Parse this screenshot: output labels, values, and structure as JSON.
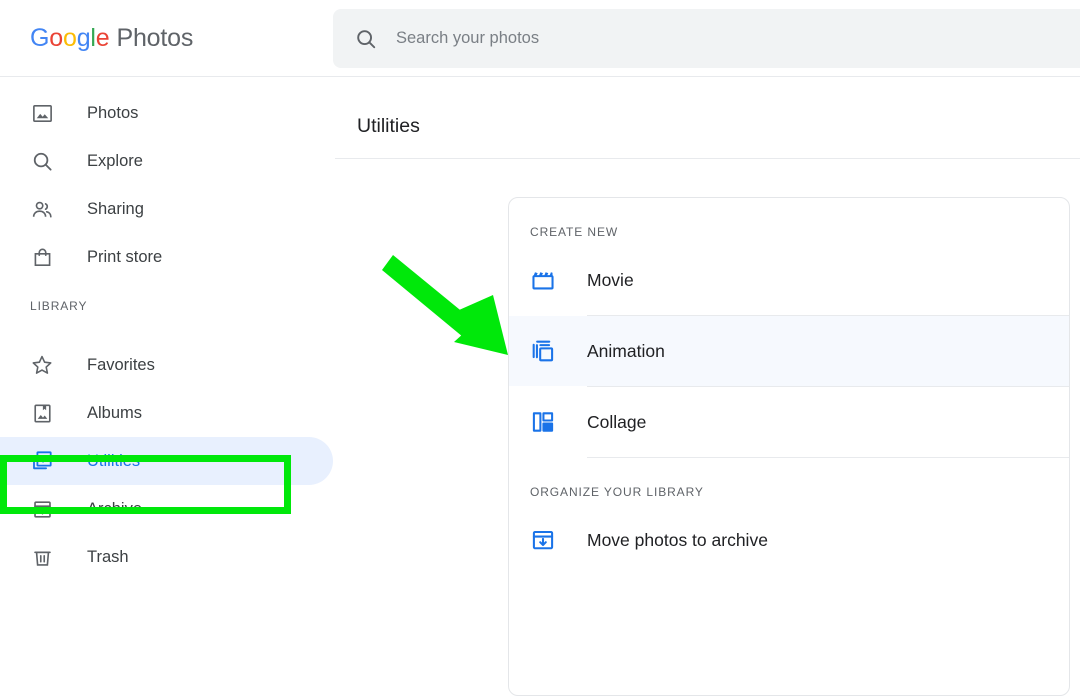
{
  "header": {
    "brand": {
      "google_letters": [
        "G",
        "o",
        "o",
        "g",
        "l",
        "e"
      ],
      "product": "Photos"
    },
    "search": {
      "placeholder": "Search your photos",
      "value": "",
      "icon": "search-icon"
    }
  },
  "sidebar": {
    "primary_items": [
      {
        "label": "Photos",
        "icon": "photo-icon",
        "active": false
      },
      {
        "label": "Explore",
        "icon": "search-icon",
        "active": false
      },
      {
        "label": "Sharing",
        "icon": "people-icon",
        "active": false
      },
      {
        "label": "Print store",
        "icon": "shopping-bag-icon",
        "active": false
      }
    ],
    "library_section_label": "LIBRARY",
    "library_items": [
      {
        "label": "Favorites",
        "icon": "star-icon",
        "active": false
      },
      {
        "label": "Albums",
        "icon": "album-icon",
        "active": false
      },
      {
        "label": "Utilities",
        "icon": "utilities-icon",
        "active": true
      },
      {
        "label": "Archive",
        "icon": "archive-icon",
        "active": false
      },
      {
        "label": "Trash",
        "icon": "trash-icon",
        "active": false
      }
    ]
  },
  "main": {
    "page_title": "Utilities",
    "card": {
      "create_new_label": "CREATE NEW",
      "create_new_items": [
        {
          "label": "Movie",
          "icon": "movie-clapper-icon",
          "hovered": false
        },
        {
          "label": "Animation",
          "icon": "layers-icon",
          "hovered": true
        },
        {
          "label": "Collage",
          "icon": "collage-grid-icon",
          "hovered": false
        }
      ],
      "organize_label": "ORGANIZE YOUR LIBRARY",
      "organize_items": [
        {
          "label": "Move photos to archive",
          "icon": "archive-down-icon",
          "hovered": false
        }
      ]
    }
  },
  "annotations": {
    "highlight_color": "#00e80a",
    "highlight_target": "Utilities",
    "arrow_target": "Animation"
  },
  "colors": {
    "accent_blue": "#1a73e8",
    "active_row_bg": "#e8f0fe",
    "hover_row_bg": "#f6f9fe",
    "text_primary": "#202124",
    "text_secondary": "#5f6368",
    "divider": "#e8eaed",
    "search_bg": "#f1f3f4"
  }
}
